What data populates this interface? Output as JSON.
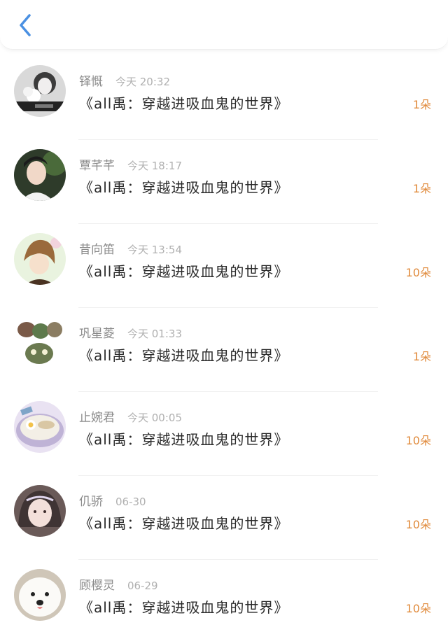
{
  "header": {
    "back_icon": "chevron-left-icon"
  },
  "colors": {
    "accent": "#4a90e2",
    "count": "#e08a3b",
    "name": "#8a8a8a",
    "time": "#b0b0b0",
    "title": "#2b2b2b"
  },
  "items": [
    {
      "name": "铎慨",
      "time": "今天 20:32",
      "title": "《all禹：穿越进吸血鬼的世界》",
      "count": "1朵"
    },
    {
      "name": "覃芊芊",
      "time": "今天 18:17",
      "title": "《all禹：穿越进吸血鬼的世界》",
      "count": "1朵"
    },
    {
      "name": "昔向笛",
      "time": "今天 13:54",
      "title": "《all禹：穿越进吸血鬼的世界》",
      "count": "10朵"
    },
    {
      "name": "巩星菱",
      "time": "今天 01:33",
      "title": "《all禹：穿越进吸血鬼的世界》",
      "count": "1朵"
    },
    {
      "name": "止婉君",
      "time": "今天 00:05",
      "title": "《all禹：穿越进吸血鬼的世界》",
      "count": "10朵"
    },
    {
      "name": "仉骄",
      "time": "06-30",
      "title": "《all禹：穿越进吸血鬼的世界》",
      "count": "10朵"
    },
    {
      "name": "顾樱灵",
      "time": "06-29",
      "title": "《all禹：穿越进吸血鬼的世界》",
      "count": "10朵"
    }
  ]
}
